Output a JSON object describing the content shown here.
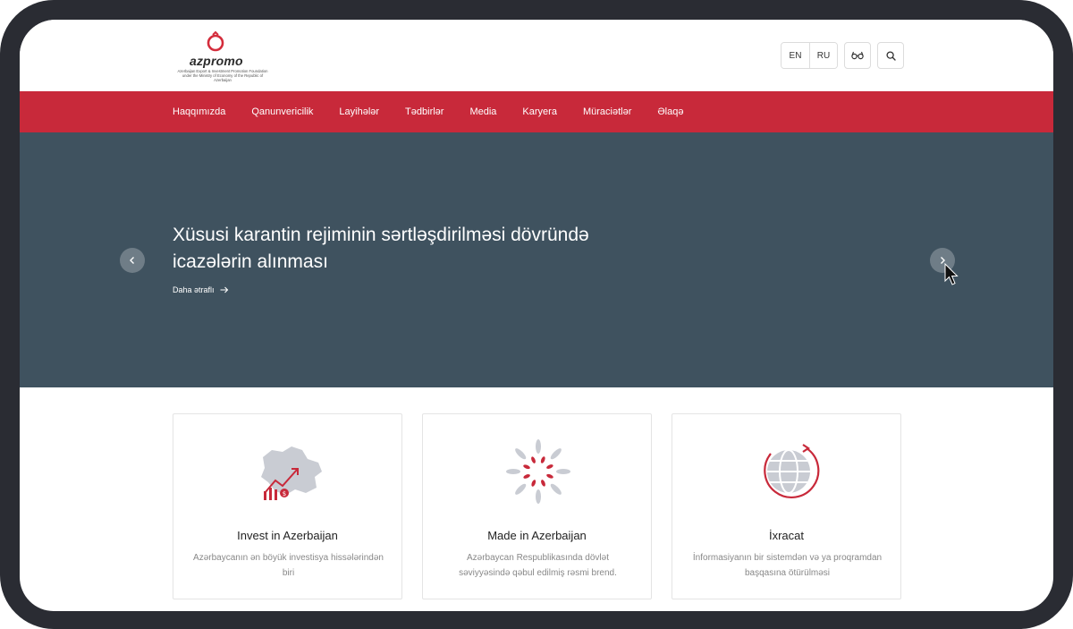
{
  "header": {
    "logo_word": "azpromo",
    "logo_subtitle": "Azerbaijan Export & Investment Promotion Foundation under the Ministry of Economy of the Republic of Azerbaijan",
    "lang_en": "EN",
    "lang_ru": "RU",
    "accessibility_icon": "glasses-icon",
    "search_icon": "search-icon"
  },
  "nav": {
    "items": [
      "Haqqımızda",
      "Qanunvericilik",
      "Layihələr",
      "Tədbirlər",
      "Media",
      "Karyera",
      "Müraciətlər",
      "Əlaqə"
    ]
  },
  "hero": {
    "title": "Xüsusi karantin rejiminin sərtləşdirilməsi dövründə icazələrin alınması",
    "more_link": "Daha ətraflı"
  },
  "cards": [
    {
      "title": "Invest in Azerbaijan",
      "text": "Azərbaycanın ən böyük investisya hissələrindən biri",
      "icon": "invest-map-icon"
    },
    {
      "title": "Made in Azerbaijan",
      "text": "Azərbaycan Respublikasında dövlət səviyyəsində qəbul edilmiş rəsmi brend.",
      "icon": "made-in-az-icon"
    },
    {
      "title": "İxracat",
      "text": "İnformasiyanın bir sistemdən və ya proqramdan başqasına ötürülməsi",
      "icon": "globe-export-icon"
    }
  ],
  "colors": {
    "brand_red": "#c8293a",
    "hero_bg": "#3f525f",
    "frame": "#2a2c33"
  }
}
